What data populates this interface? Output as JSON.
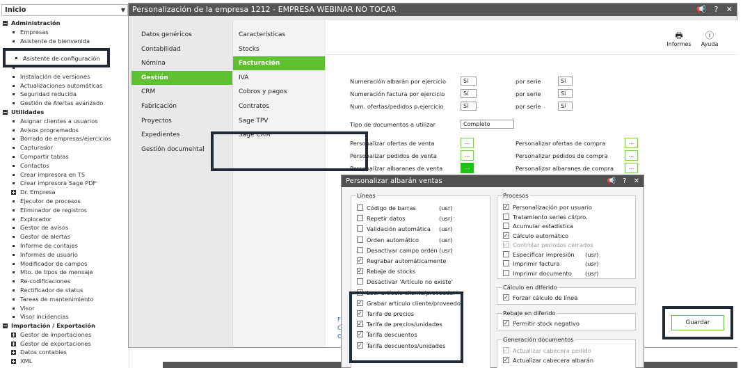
{
  "sidebar": {
    "inicio": "Inicio",
    "highlighted": "Asistente de configuración",
    "tree": [
      {
        "t": "h",
        "label": "Administración"
      },
      {
        "t": "i",
        "label": "Empresas"
      },
      {
        "t": "i",
        "label": "Asistente de bienvenida"
      },
      {
        "t": "i",
        "label": ""
      },
      {
        "t": "i",
        "label": ""
      },
      {
        "t": "i",
        "label": ""
      },
      {
        "t": "i",
        "label": "Instalación de versiones"
      },
      {
        "t": "i",
        "label": "Actualizaciones automáticas"
      },
      {
        "t": "i",
        "label": "Seguridad reducida"
      },
      {
        "t": "i",
        "label": "Gestión de Alertas avanzado"
      },
      {
        "t": "h",
        "label": "Utilidades"
      },
      {
        "t": "i",
        "label": "Asignar clientes a usuarios"
      },
      {
        "t": "i",
        "label": "Avisos programados"
      },
      {
        "t": "i",
        "label": "Borrado de empresas/ejercicios"
      },
      {
        "t": "i",
        "label": "Capturador"
      },
      {
        "t": "i",
        "label": "Compartir tablas"
      },
      {
        "t": "i",
        "label": "Contactos"
      },
      {
        "t": "i",
        "label": "Crear impresora en TS"
      },
      {
        "t": "i",
        "label": "Crear impresora Sage PDF"
      },
      {
        "t": "p",
        "label": "Dr. Empresa"
      },
      {
        "t": "i",
        "label": "Ejecutor de procesos"
      },
      {
        "t": "i",
        "label": "Eliminador de registros"
      },
      {
        "t": "i",
        "label": "Explorador"
      },
      {
        "t": "i",
        "label": "Gestor de avisos"
      },
      {
        "t": "i",
        "label": "Gestor de alertas"
      },
      {
        "t": "i",
        "label": "Informe de contajes"
      },
      {
        "t": "i",
        "label": "Informes de usuario"
      },
      {
        "t": "i",
        "label": "Modificador de campos"
      },
      {
        "t": "i",
        "label": "Mto. de tipos de mensaje"
      },
      {
        "t": "i",
        "label": "Re-codificaciones"
      },
      {
        "t": "i",
        "label": "Rectificador de status"
      },
      {
        "t": "i",
        "label": "Tareas de mantenimiento"
      },
      {
        "t": "i",
        "label": "Visor"
      },
      {
        "t": "i",
        "label": "Visor incidencias"
      },
      {
        "t": "h",
        "label": "Importación / Exportación"
      },
      {
        "t": "p",
        "label": "Gestor de importaciones"
      },
      {
        "t": "p",
        "label": "Gestor de exportaciones"
      },
      {
        "t": "p",
        "label": "Datos contables"
      },
      {
        "t": "p",
        "label": "XML"
      }
    ]
  },
  "window": {
    "title": "Personalización de la empresa  1212 - EMPRESA WEBINAR NO TOCAR",
    "ctrl_announce": "📢",
    "ctrl_help": "?",
    "ctrl_close": "✕"
  },
  "menu1": [
    "Datos genéricos",
    "Contabilidad",
    "Nómina",
    "Gestión",
    "CRM",
    "Fabricación",
    "Proyectos",
    "Expedientes",
    "Gestión documental"
  ],
  "menu1_active": 3,
  "menu2": [
    "Características",
    "Stocks",
    "Facturación",
    "IVA",
    "Cobros y pagos",
    "Contratos",
    "Sage TPV",
    "Sage CRM"
  ],
  "menu2_active": 2,
  "toolbar": {
    "informes": "Informes",
    "ayuda": "Ayuda"
  },
  "form": {
    "num_albaran": "Numeración albarán por ejercicio",
    "num_albaran_val": "Sí",
    "num_factura": "Numeración factura por ejercicio",
    "num_factura_val": "Sí",
    "num_ofertas": "Num. ofertas/pedidos p.ejercicio",
    "num_ofertas_val": "Sí",
    "por_serie": "por serie",
    "por_serie_val1": "Sí",
    "por_serie_val2": "Sí",
    "por_serie_val3": "Sí",
    "tipo_doc": "Tipo de documentos a utilizar",
    "tipo_doc_val": "Completo",
    "pers_ofertas_venta": "Personalizar ofertas de venta",
    "pers_pedidos_venta": "Personalizar pedidos de venta",
    "pers_albaranes_venta": "Personalizar albaranes de venta",
    "pers_ofertas_compra": "Personalizar ofertas de compra",
    "pers_pedidos_compra": "Personalizar pedidos de compra",
    "pers_albaranes_compra": "Personalizar albaranes de compra",
    "dots": "...",
    "guardar": "Guardar",
    "link1": "F",
    "link2": "C",
    "link3": "C"
  },
  "dialog": {
    "title": "Personalizar albarán ventas",
    "ctrl_announce": "📢",
    "ctrl_help": "?",
    "ctrl_close": "✕",
    "lineas_title": "Líneas",
    "lineas": [
      {
        "label": "Código de barras",
        "usr": "(usr)",
        "checked": false
      },
      {
        "label": "Repetir datos",
        "usr": "(usr)",
        "checked": false
      },
      {
        "label": "Validación automática",
        "usr": "(usr)",
        "checked": false
      },
      {
        "label": "Orden automático",
        "usr": "(usr)",
        "checked": false
      },
      {
        "label": "Desactivar campo orden",
        "usr": "(usr)",
        "checked": false
      },
      {
        "label": "Regrabar automáticamente",
        "usr": "",
        "checked": true
      },
      {
        "label": "Rebaje de stocks",
        "usr": "",
        "checked": true
      },
      {
        "label": "Desactivar 'Artículo no existe'",
        "usr": "",
        "checked": false
      },
      {
        "label": "Leer artículo cliente/proveedor",
        "usr": "",
        "checked": true
      },
      {
        "label": "Grabar artículo cliente/proveedor",
        "usr": "",
        "checked": true
      },
      {
        "label": "Tarifa de precios",
        "usr": "",
        "checked": true
      },
      {
        "label": "Tarifa de precios/unidades",
        "usr": "",
        "checked": true
      },
      {
        "label": "Tarifa descuentos",
        "usr": "",
        "checked": true
      },
      {
        "label": "Tarifa descuentos/unidades",
        "usr": "",
        "checked": true
      }
    ],
    "procesos_title": "Procesos",
    "procesos": [
      {
        "label": "Personalización por usuario",
        "usr": "",
        "checked": true,
        "disabled": false
      },
      {
        "label": "Tratamiento series cli/pro.",
        "usr": "",
        "checked": false,
        "disabled": false
      },
      {
        "label": "Acumular estadística",
        "usr": "",
        "checked": false,
        "disabled": false
      },
      {
        "label": "Cálculo automático",
        "usr": "",
        "checked": true,
        "disabled": false
      },
      {
        "label": "Controlar periodos cerrados",
        "usr": "",
        "checked": true,
        "disabled": true
      },
      {
        "label": "Especificar impresión",
        "usr": "(usr)",
        "checked": false,
        "disabled": false
      },
      {
        "label": "Imprimir factura",
        "usr": "(usr)",
        "checked": false,
        "disabled": false
      },
      {
        "label": "Imprimir documento",
        "usr": "(usr)",
        "checked": false,
        "disabled": false
      }
    ],
    "calculo_title": "Cálculo en diferido",
    "calculo_item": "Forzar cálculo de línea",
    "rebaje_title": "Rebaje en diferido",
    "rebaje_item": "Permitir stock negativo",
    "generacion_title": "Generación documentos",
    "generacion": [
      {
        "label": "Actualizar cabecera pedido",
        "checked": true,
        "disabled": true
      },
      {
        "label": "Actualizar cabecera albarán",
        "checked": true,
        "disabled": false
      }
    ]
  }
}
